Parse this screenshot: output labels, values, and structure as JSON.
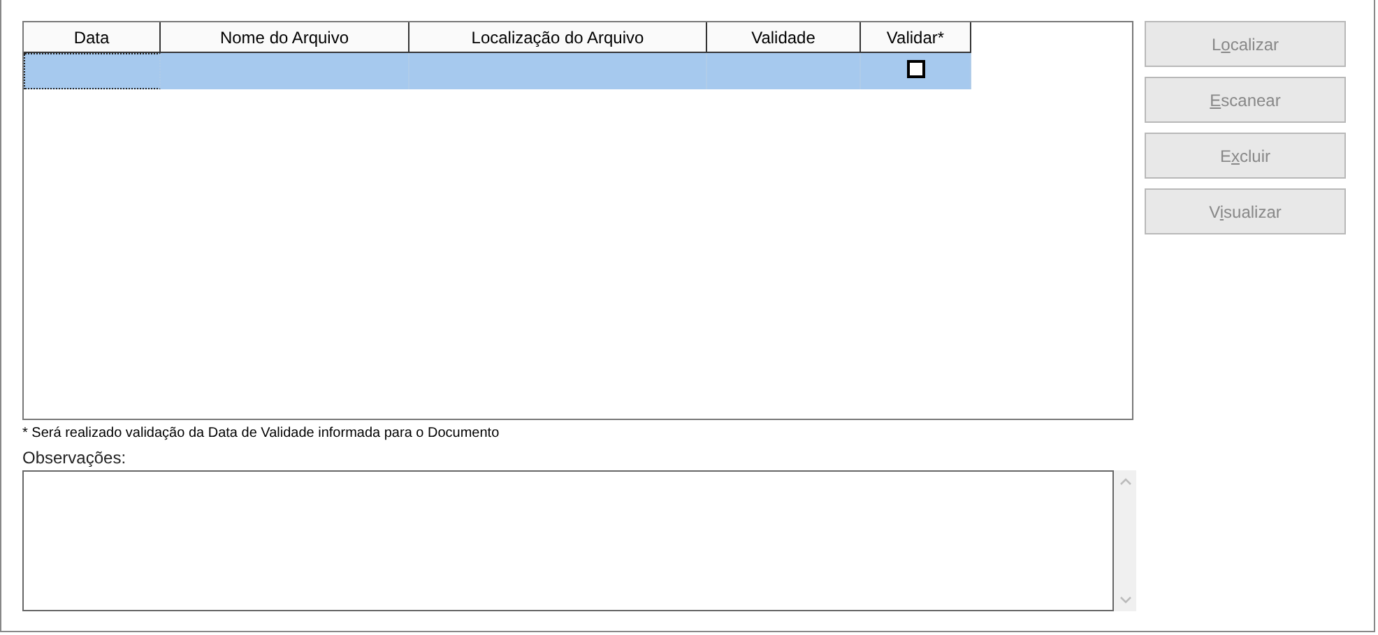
{
  "table": {
    "columns": [
      "Data",
      "Nome do Arquivo",
      "Localização do Arquivo",
      "Validade",
      "Validar*"
    ],
    "rows": [
      {
        "selected": true,
        "cells": [
          {
            "kind": "text",
            "focused": true
          },
          {
            "kind": "text",
            "focused": false
          },
          {
            "kind": "text",
            "focused": false
          },
          {
            "kind": "text",
            "focused": false
          },
          {
            "kind": "checkbox",
            "checked": false,
            "focused": false
          }
        ]
      }
    ]
  },
  "buttons": [
    {
      "pre": "L",
      "key": "o",
      "post": "calizar",
      "disabled": true
    },
    {
      "key": "E",
      "post": "scanear",
      "disabled": true
    },
    {
      "pre": "E",
      "key": "x",
      "post": "cluir",
      "disabled": true
    },
    {
      "pre": "V",
      "key": "i",
      "post": "sualizar",
      "disabled": true
    }
  ],
  "note": "* Será realizado validação da Data de Validade informada para o Documento",
  "observations": {
    "label": "Observações:"
  }
}
